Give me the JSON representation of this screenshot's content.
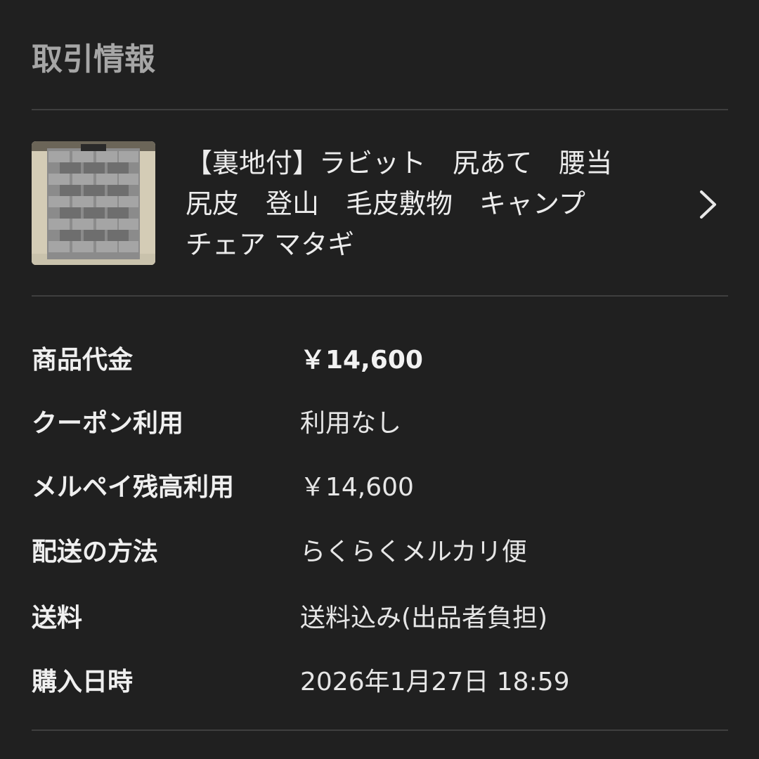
{
  "section": {
    "title": "取引情報"
  },
  "item": {
    "thumbnail_icon": "fur-rug-photo",
    "title": "【裏地付】ラビット　尻あて　腰当\n尻皮　登山　毛皮敷物　キャンプ\nチェア マタギ",
    "chevron_icon": "chevron-right-icon"
  },
  "details": [
    {
      "label": "商品代金",
      "value": "￥14,600"
    },
    {
      "label": "クーポン利用",
      "value": "利用なし"
    },
    {
      "label": "メルペイ残高利用",
      "value": "￥14,600"
    },
    {
      "label": "配送の方法",
      "value": "らくらくメルカリ便"
    },
    {
      "label": "送料",
      "value": "送料込み(出品者負担)"
    },
    {
      "label": "購入日時",
      "value": "2026年1月27日 18:59"
    }
  ],
  "colors": {
    "background": "#202020",
    "divider": "#3f3f3f",
    "title_muted": "#a6a6a6",
    "text": "#eeeeee"
  }
}
